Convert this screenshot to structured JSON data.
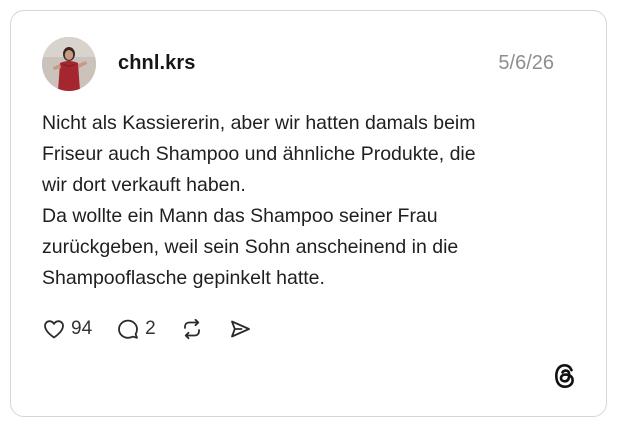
{
  "post": {
    "username": "chnl.krs",
    "date": "5/6/26",
    "text_lines": [
      "Nicht als Kassiererin, aber wir hatten damals beim",
      "Friseur auch Shampoo und ähnliche Produkte, die",
      "wir dort verkauft haben.",
      "Da wollte ein Mann das Shampoo seiner Frau",
      "zurückgeben, weil sein Sohn anscheinend in die",
      "Shampooflasche gepinkelt hatte."
    ],
    "likes": "94",
    "replies": "2"
  },
  "icons": {
    "like": "heart-icon",
    "reply": "comment-bubble-icon",
    "repost": "repost-icon",
    "share": "send-icon",
    "brand": "threads-logo-icon"
  },
  "colors": {
    "border": "#d6d6d6",
    "text": "#1f1f1f",
    "muted": "#8e8e8e"
  }
}
